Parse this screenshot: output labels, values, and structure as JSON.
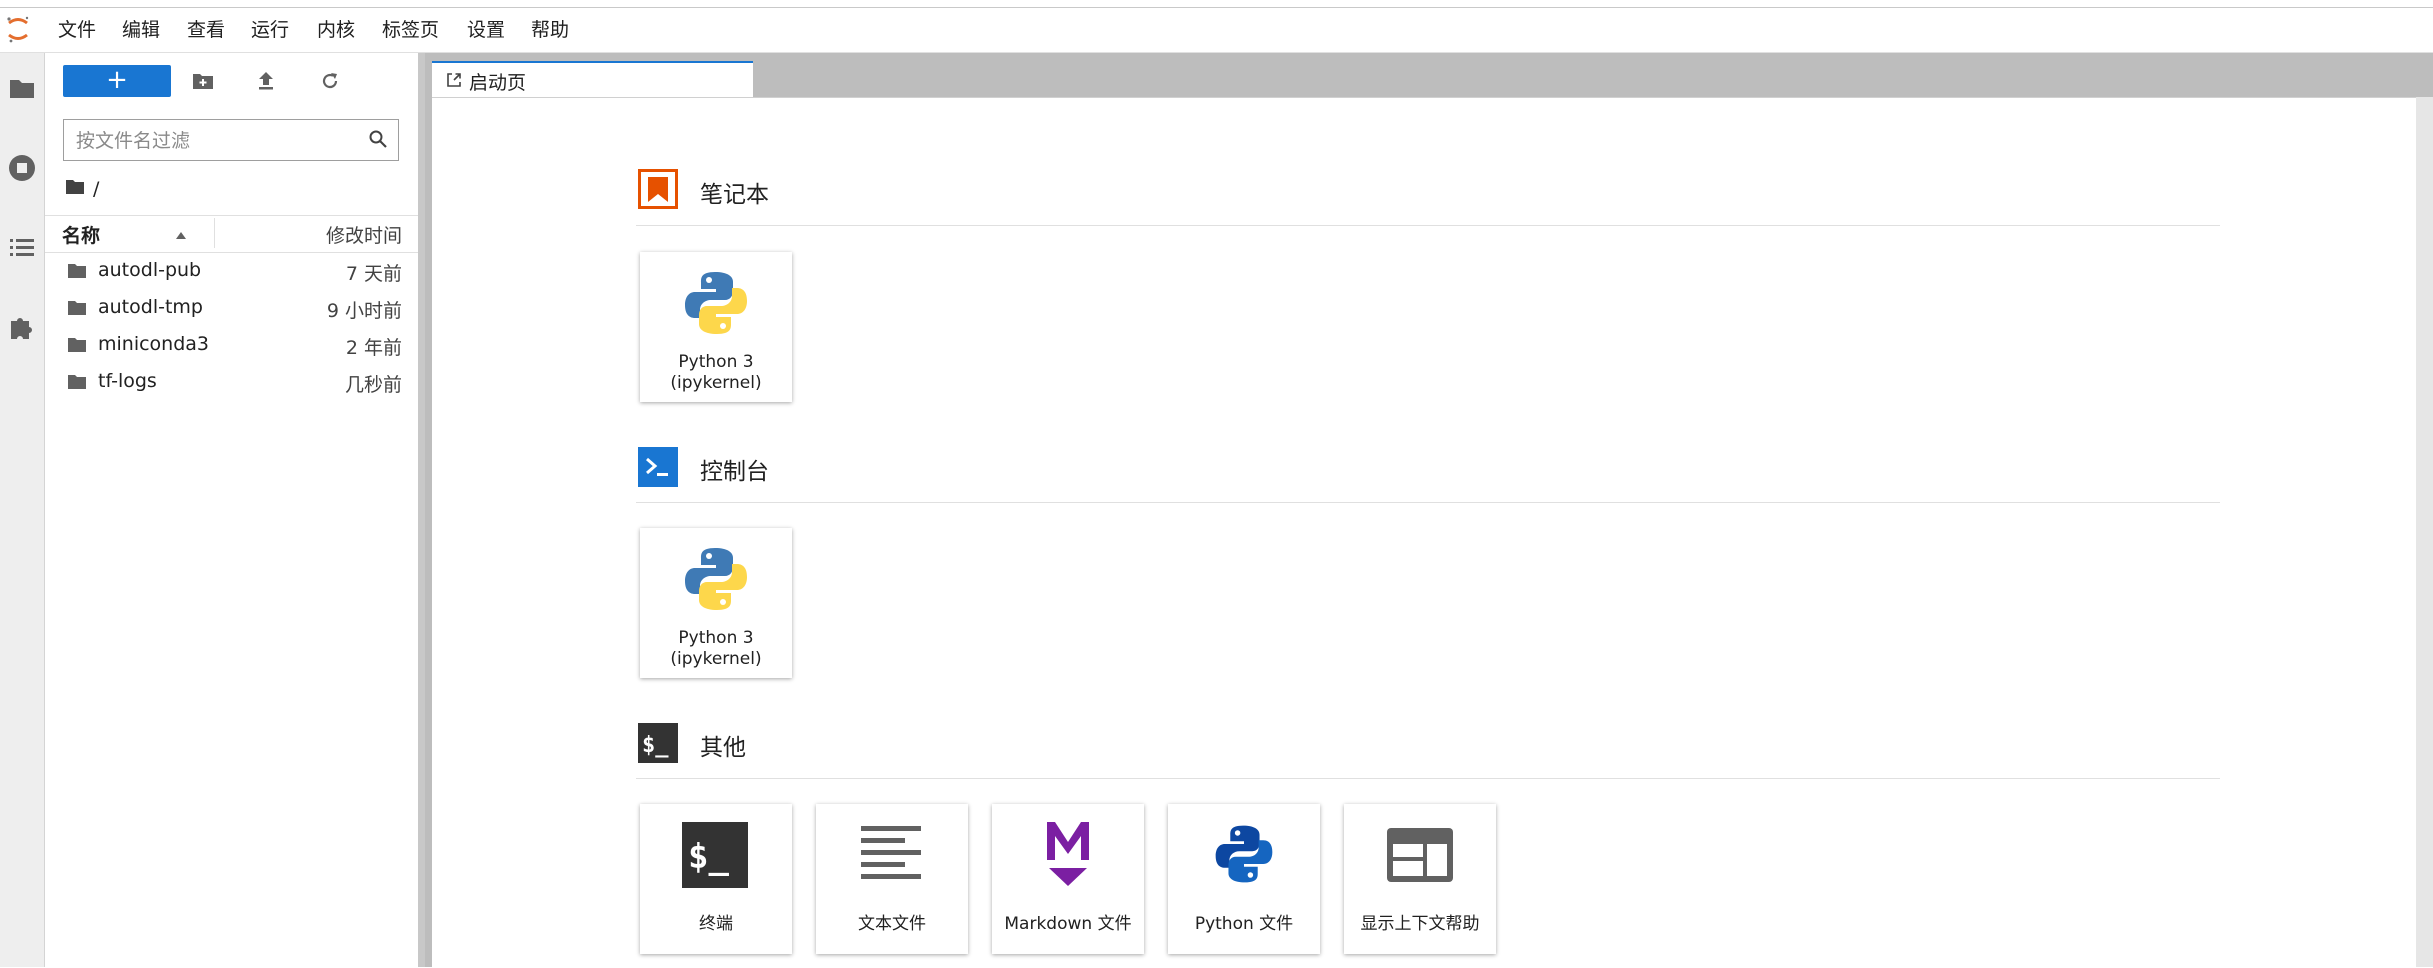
{
  "menu": [
    "文件",
    "编辑",
    "查看",
    "运行",
    "内核",
    "标签页",
    "设置",
    "帮助"
  ],
  "toolbar": {
    "new_label": "+"
  },
  "filter": {
    "placeholder": "按文件名过滤"
  },
  "breadcrumb": "/",
  "columns": {
    "name": "名称",
    "modified": "修改时间"
  },
  "files": [
    {
      "name": "autodl-pub",
      "modified": "7 天前"
    },
    {
      "name": "autodl-tmp",
      "modified": "9 小时前"
    },
    {
      "name": "miniconda3",
      "modified": "2 年前"
    },
    {
      "name": "tf-logs",
      "modified": "几秒前"
    }
  ],
  "tab": {
    "label": "启动页"
  },
  "sections": {
    "notebook": {
      "title": "笔记本",
      "cards": [
        {
          "line1": "Python 3",
          "line2": "(ipykernel)"
        }
      ]
    },
    "console": {
      "title": "控制台",
      "cards": [
        {
          "line1": "Python 3",
          "line2": "(ipykernel)"
        }
      ]
    },
    "other": {
      "title": "其他",
      "cards": [
        {
          "label": "终端"
        },
        {
          "label": "文本文件"
        },
        {
          "label": "Markdown 文件"
        },
        {
          "label": "Python 文件"
        },
        {
          "label": "显示上下文帮助"
        }
      ]
    }
  },
  "colors": {
    "accent": "#1976d2",
    "notebook": "#e65100",
    "markdown": "#7b1fa2",
    "terminal": "#333333"
  },
  "icons": {
    "activity": [
      "folder-icon",
      "running-icon",
      "toc-icon",
      "extension-icon"
    ],
    "toolbar": [
      "new-folder-icon",
      "upload-icon",
      "refresh-icon"
    ]
  }
}
